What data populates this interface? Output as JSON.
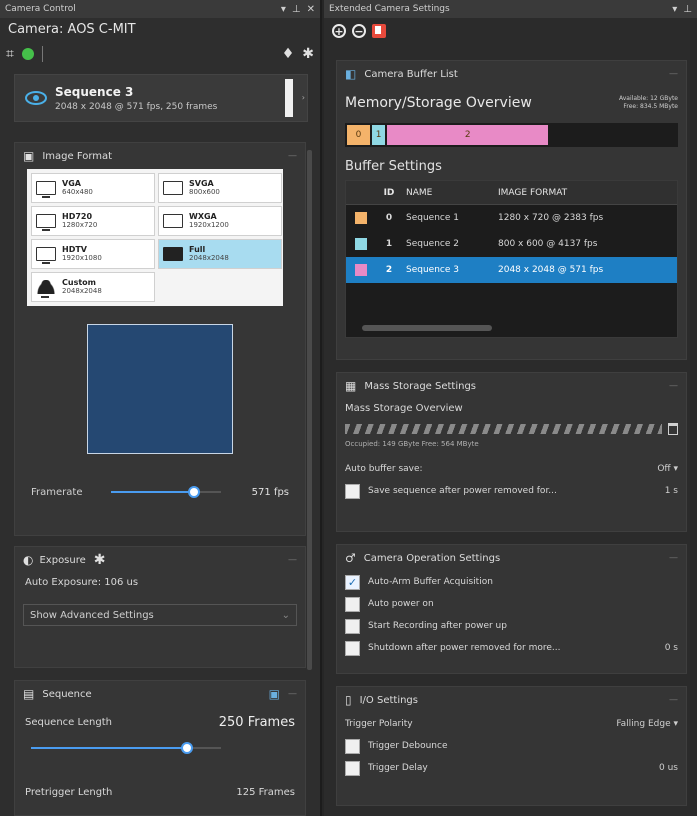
{
  "left_panel": {
    "title": "Camera Control",
    "camera_label": "Camera:  AOS C-MIT",
    "sequence": {
      "name": "Sequence 3",
      "details": "2048 x 2048 @ 571 fps, 250 frames"
    },
    "image_format": {
      "title": "Image Format",
      "formats": [
        {
          "name": "VGA",
          "res": "640x480"
        },
        {
          "name": "SVGA",
          "res": "800x600"
        },
        {
          "name": "HD720",
          "res": "1280x720"
        },
        {
          "name": "WXGA",
          "res": "1920x1200"
        },
        {
          "name": "HDTV",
          "res": "1920x1080"
        },
        {
          "name": "Full",
          "res": "2048x2048"
        },
        {
          "name": "Custom",
          "res": "2048x2048"
        }
      ],
      "selected_index": 5
    },
    "framerate": {
      "label": "Framerate",
      "value": "571 fps",
      "level": 0.75
    },
    "exposure": {
      "title": "Exposure",
      "auto_text": "Auto Exposure: 106 us",
      "advanced_label": "Show Advanced Settings"
    },
    "sequence_section": {
      "title": "Sequence",
      "length_label": "Sequence Length",
      "length_value": "250 Frames",
      "length_level": 0.82,
      "pretrigger_label": "Pretrigger Length",
      "pretrigger_value": "125 Frames"
    }
  },
  "right_panel": {
    "title": "Extended Camera Settings",
    "buffer_list": {
      "title": "Camera Buffer List",
      "overview_title": "Memory/Storage Overview",
      "available_text": "Available: 12 GByte",
      "free_text": "Free: 834.5 MByte",
      "segments": [
        {
          "label": "0",
          "color": "#f4b36a",
          "fraction": 0.07
        },
        {
          "label": "1",
          "color": "#8fd8e4",
          "fraction": 0.04
        },
        {
          "label": "2",
          "color": "#e88ac6",
          "fraction": 0.49
        }
      ],
      "settings_title": "Buffer Settings",
      "columns": [
        "ID",
        "NAME",
        "IMAGE FORMAT"
      ],
      "rows": [
        {
          "id": "0",
          "name": "Sequence 1",
          "format": "1280 x  720 @  2383 fps",
          "color": "#f4b36a"
        },
        {
          "id": "1",
          "name": "Sequence 2",
          "format": "800 x  600 @   4137 fps",
          "color": "#8fd8e4"
        },
        {
          "id": "2",
          "name": "Sequence 3",
          "format": "2048 x  2048 @   571 fps",
          "color": "#e88ac6"
        }
      ],
      "selected_row": 2
    },
    "mass_storage": {
      "title": "Mass Storage Settings",
      "overview_label": "Mass Storage Overview",
      "occupied_text": "Occupied: 149 GByte    Free: 564 MByte",
      "auto_save_label": "Auto buffer save:",
      "auto_save_value": "Off",
      "save_seq_label": "Save sequence after power removed for...",
      "save_seq_value": "1 s"
    },
    "operation": {
      "title": "Camera Operation Settings",
      "options": [
        {
          "label": "Auto-Arm Buffer Acquisition",
          "checked": true,
          "value": ""
        },
        {
          "label": "Auto power on",
          "checked": false,
          "value": ""
        },
        {
          "label": "Start Recording after power up",
          "checked": false,
          "value": ""
        },
        {
          "label": "Shutdown after power removed for more...",
          "checked": false,
          "value": "0 s"
        }
      ]
    },
    "io": {
      "title": "I/O Settings",
      "trigger_polarity_label": "Trigger Polarity",
      "trigger_polarity_value": "Falling Edge",
      "debounce_label": "Trigger Debounce",
      "delay_label": "Trigger Delay",
      "delay_value": "0 us"
    }
  }
}
